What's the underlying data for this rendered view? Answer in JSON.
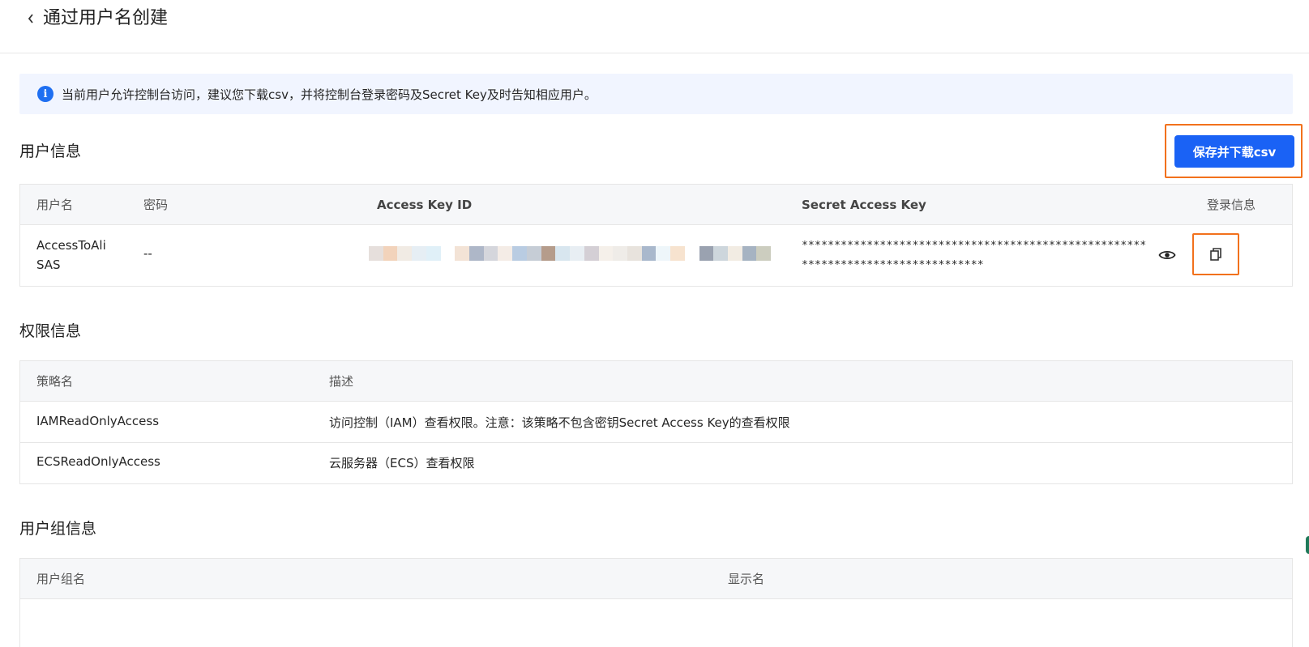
{
  "header": {
    "back_icon": "chevron-left-icon",
    "title": "通过用户名创建"
  },
  "alert": {
    "icon": "info-icon",
    "icon_glyph": "i",
    "text": "当前用户允许控制台访问，建议您下载csv，并将控制台登录密码及Secret Key及时告知相应用户。"
  },
  "user_info": {
    "title": "用户信息",
    "save_button": "保存并下载csv",
    "columns": [
      "用户名",
      "密码",
      "Access Key ID",
      "Secret Access Key",
      "登录信息"
    ],
    "row": {
      "username_line1": "AccessToAli",
      "username_line2": "SAS",
      "password": "--",
      "secret_access_key": "*********************************************************************************",
      "eye_icon": "eye-icon",
      "copy_icon": "copy-icon"
    }
  },
  "permissions": {
    "title": "权限信息",
    "columns": [
      "策略名",
      "描述"
    ],
    "rows": [
      {
        "name": "IAMReadOnlyAccess",
        "desc": "访问控制（IAM）查看权限。注意：该策略不包含密钥Secret Access Key的查看权限"
      },
      {
        "name": "ECSReadOnlyAccess",
        "desc": "云服务器（ECS）查看权限"
      }
    ]
  },
  "groups": {
    "title": "用户组信息",
    "columns": [
      "用户组名",
      "显示名"
    ]
  },
  "colors": {
    "primary": "#1a62f5",
    "highlight": "#f2711c",
    "alert_bg": "#f1f5ff"
  }
}
